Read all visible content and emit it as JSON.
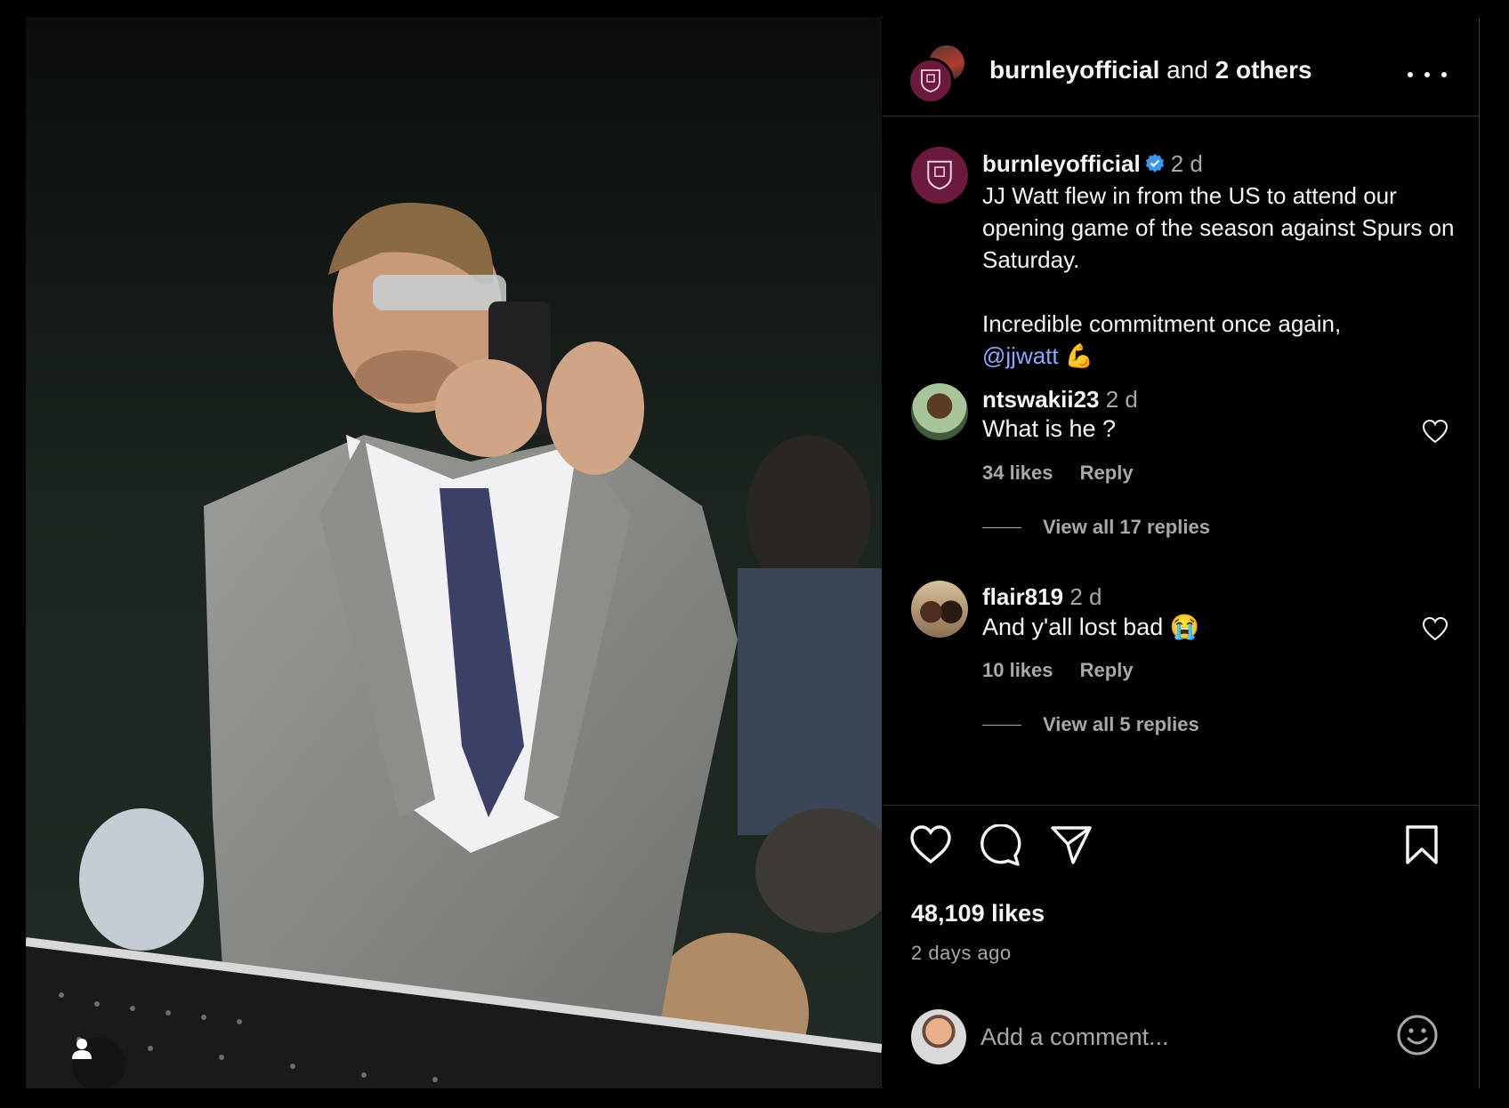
{
  "post": {
    "header": {
      "owner": "burnleyofficial",
      "joiner": "and",
      "others": "2 others"
    },
    "caption": {
      "username": "burnleyofficial",
      "time": "2 d",
      "text_1": "JJ Watt flew in from the US to attend our opening game of the season against Spurs on Saturday.",
      "text_2": "Incredible commitment once again,",
      "mention": "@jjwatt",
      "emoji": "💪"
    },
    "comments": [
      {
        "username": "ntswakii23",
        "time": "2 d",
        "text": "What is he ?",
        "likes": "34 likes",
        "reply_label": "Reply",
        "view_replies": "View all 17 replies"
      },
      {
        "username": "flair819",
        "time": "2 d",
        "text": "And y'all lost bad",
        "emoji": "😭",
        "likes": "10 likes",
        "reply_label": "Reply",
        "view_replies": "View all 5 replies"
      }
    ],
    "likes": "48,109 likes",
    "date": "2 days ago",
    "comment_placeholder": "Add a comment...",
    "icons": [
      "heart-icon",
      "comment-icon",
      "share-icon",
      "bookmark-icon",
      "emoji-icon",
      "more-icon",
      "verified-icon",
      "user-tag-icon"
    ],
    "colors": {
      "background": "#000000",
      "text": "#f5f5f5",
      "muted": "#a8a8a8",
      "mention": "#8fa6ff",
      "verified": "#3897f0",
      "club_badge": "#6b1a3d"
    }
  }
}
